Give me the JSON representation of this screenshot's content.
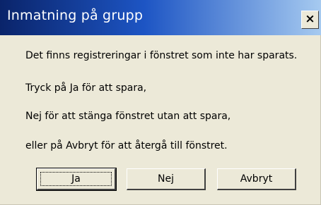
{
  "dialog": {
    "title": "Inmatning på grupp",
    "close_glyph": "×",
    "close_icon": "close-icon",
    "message_lines": [
      "Det finns registreringar i fönstret som inte har sparats.",
      "Tryck på Ja för att spara,",
      "Nej för att stänga fönstret utan att spara,",
      "eller på Avbryt för att återgå till fönstret."
    ],
    "buttons": {
      "yes": "Ja",
      "no": "Nej",
      "cancel": "Avbryt"
    }
  },
  "colors": {
    "title_bar_start": "#0a246a",
    "title_bar_end": "#a6caf0",
    "dialog_background": "#ece9d8"
  }
}
